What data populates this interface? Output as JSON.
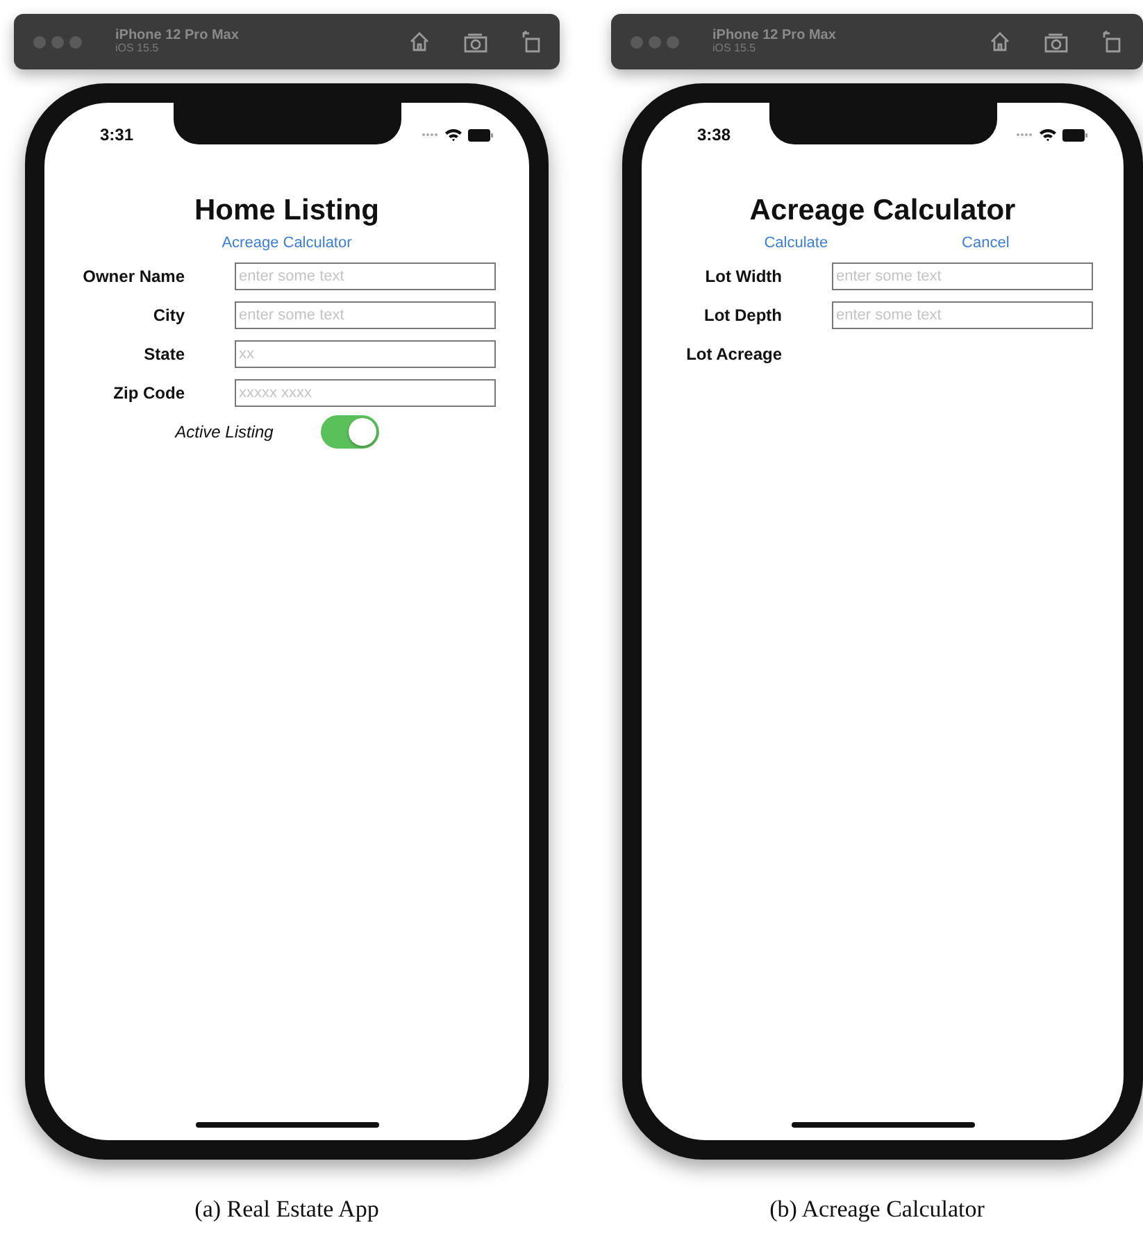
{
  "panels": [
    {
      "toolbar": {
        "device": "iPhone 12 Pro Max",
        "os": "iOS 15.5"
      },
      "time": "3:31",
      "title": "Home Listing",
      "actions": [
        "Acreage Calculator"
      ],
      "fields": [
        {
          "kind": "input",
          "label": "Owner Name",
          "placeholder": "enter some text"
        },
        {
          "kind": "input",
          "label": "City",
          "placeholder": "enter some text"
        },
        {
          "kind": "input",
          "label": "State",
          "placeholder": "xx"
        },
        {
          "kind": "input",
          "label": "Zip Code",
          "placeholder": "xxxxx xxxx"
        }
      ],
      "toggle": {
        "label": "Active Listing",
        "on": true
      },
      "caption": "(a) Real Estate App"
    },
    {
      "toolbar": {
        "device": "iPhone 12 Pro Max",
        "os": "iOS 15.5"
      },
      "time": "3:38",
      "title": "Acreage Calculator",
      "actions": [
        "Calculate",
        "Cancel"
      ],
      "fields": [
        {
          "kind": "input",
          "label": "Lot Width",
          "placeholder": "enter some text"
        },
        {
          "kind": "input",
          "label": "Lot Depth",
          "placeholder": "enter some text"
        },
        {
          "kind": "output",
          "label": "Lot Acreage"
        }
      ],
      "caption": "(b) Acreage Calculator"
    }
  ]
}
